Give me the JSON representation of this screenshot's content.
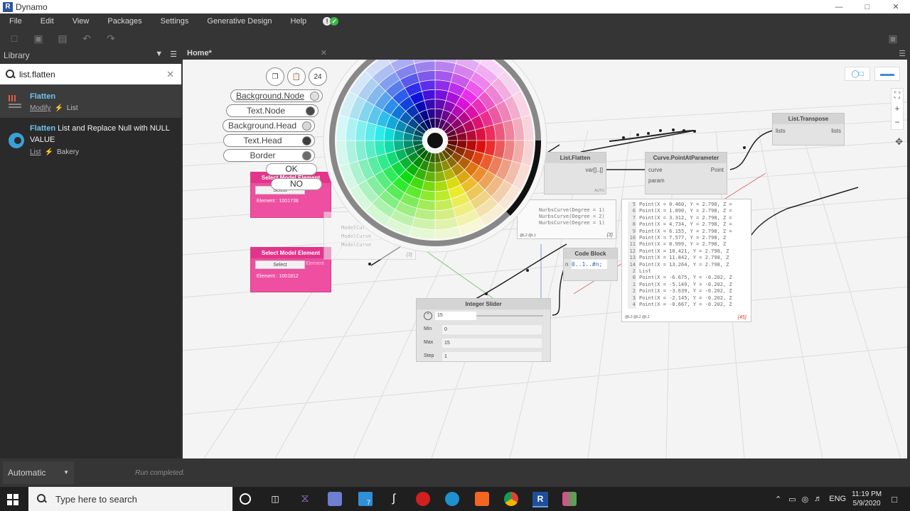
{
  "window": {
    "title": "Dynamo",
    "app_letter": "R"
  },
  "menu": {
    "items": [
      "File",
      "Edit",
      "View",
      "Packages",
      "Settings",
      "Generative Design",
      "Help"
    ]
  },
  "library": {
    "header": "Library",
    "search": {
      "value": "list.flatten",
      "placeholder": ""
    },
    "results": [
      {
        "title_highlight": "Flatten",
        "title_rest": "",
        "category": "Modify",
        "group": "List"
      },
      {
        "title_highlight": "Flatten",
        "title_rest": " List and Replace Null with NULL VALUE",
        "category": "List",
        "group": "Bakery"
      }
    ]
  },
  "tab": {
    "label": "Home*"
  },
  "color_picker": {
    "count_label": "24",
    "items": [
      {
        "label": "Background.Node",
        "color": "#e0e0e0"
      },
      {
        "label": "Text.Node",
        "color": "#4a4a4a"
      },
      {
        "label": "Background.Head",
        "color": "#d6d6d6"
      },
      {
        "label": "Text.Head",
        "color": "#3d3d3d"
      },
      {
        "label": "Border",
        "color": "#6b6b6b"
      }
    ],
    "ok_label": "OK",
    "no_label": "NO"
  },
  "nodes": {
    "select_a": {
      "title": "Select Model Element",
      "button": "Select",
      "element": "Element : 1001738"
    },
    "select_b": {
      "title": "Select Model Element",
      "button": "Select",
      "port": "Element",
      "element": "Element : 1001812"
    },
    "list_flatten": {
      "title": "List.Flatten",
      "out": "var[]..[]"
    },
    "curve_point": {
      "title": "Curve.PointAtParameter",
      "in1": "curve",
      "in2": "param",
      "out": "Point"
    },
    "list_transpose": {
      "title": "List.Transpose",
      "in": "lists",
      "out": "lists"
    },
    "code_block": {
      "title": "Code Block",
      "code": "0..1..#n;",
      "port_in": "n"
    },
    "integer_slider": {
      "title": "Integer Slider",
      "value": "15",
      "min_label": "Min",
      "min": "0",
      "max_label": "Max",
      "max": "15",
      "step_label": "Step",
      "step": "1"
    },
    "curve_preview": {
      "lines": [
        "NurbsCurve(Degree = 1)",
        "NurbsCurve(Degree = 2)",
        "NurbsCurve(Degree = 1)"
      ],
      "count": "{3}",
      "footer": "@L2 @L1"
    },
    "points_preview": {
      "lines": [
        "Point(X = 0.460, Y = 2.798, Z =",
        "Point(X = 1.890, Y = 2.798, Z =",
        "Point(X = 3.312, Y = 2.798, Z =",
        "Point(X = 4.734, Y = 2.798, Z =",
        "Point(X = 6.155, Y = 2.798, Z =",
        "Point(X = 7.577, Y = 2.798, Z",
        "Point(X = 8.999, Y = 2.798, Z",
        "Point(X = 10.421, Y = 2.798, Z",
        "Point(X = 11.842, Y = 2.798, Z",
        "Point(X = 13.264, Y = 2.798, Z",
        "List",
        "Point(X = -6.675, Y = -0.202, Z",
        "Point(X = -5.149, Y = -0.202, Z",
        "Point(X = -3.639, Y = -0.202, Z",
        "Point(X = -2.145, Y = -0.202, Z",
        "Point(X = -0.667, Y = -0.202, Z"
      ],
      "indices": [
        "5",
        "6",
        "7",
        "8",
        "9",
        "10",
        "11",
        "12",
        "13",
        "14",
        "2",
        "0",
        "1",
        "2",
        "3",
        "4"
      ],
      "count": "{45}",
      "footer": "@L3 @L2 @L1"
    },
    "model_curve_preview": {
      "lines": [
        "ModelCurve",
        "ModelCurve",
        "ModelCurve"
      ],
      "count": "{3}"
    }
  },
  "status": {
    "run_mode": "Automatic",
    "message": "Run completed."
  },
  "taskbar": {
    "search_placeholder": "Type here to search",
    "lang": "ENG",
    "time": "11:19 PM",
    "date": "5/9/2020",
    "badge": "7"
  },
  "colors": {
    "accent_blue": "#6fc3ee",
    "pink_node": "#ee4fa0",
    "canvas": "#f4f4f4"
  }
}
